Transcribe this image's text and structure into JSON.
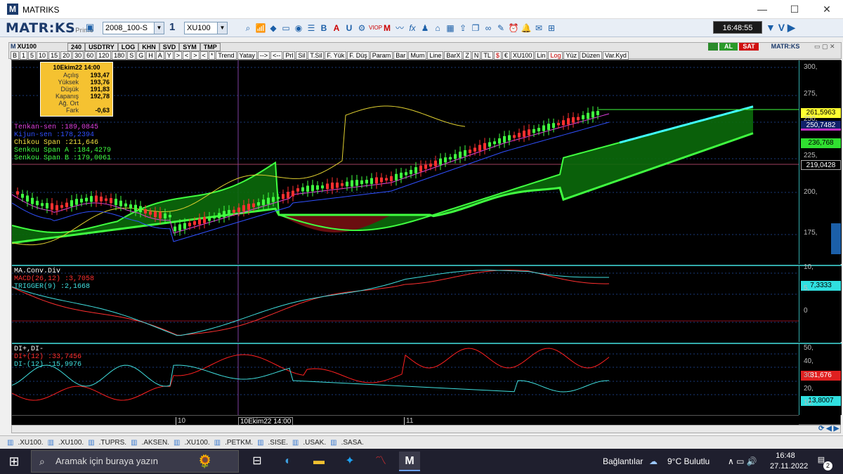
{
  "window": {
    "title": "MATRIKS",
    "min": "—",
    "max": "☐",
    "close": "✕"
  },
  "toolbar": {
    "brand": "MATR:KS",
    "brand_sub": "Prime",
    "template": "2008_100-S",
    "count": "1",
    "symbol": "XU100",
    "clock": "16:48:55"
  },
  "toolbar2": {
    "left_tabs": [
      "XU100",
      "240",
      "USDTRY",
      "LOG",
      "KHN",
      "SVD",
      "SYM",
      "TMP"
    ],
    "periods": [
      "B",
      "1",
      "5",
      "10",
      "15",
      "20",
      "30",
      "60",
      "120",
      "180",
      "S",
      "G",
      "H",
      "A",
      "Y",
      ">",
      "<",
      ">",
      "<",
      "*"
    ],
    "tools": [
      "Trend",
      "Yatay",
      "-->",
      "<--",
      "Prl",
      "Sil",
      "T.Sil",
      "F. Yük",
      "F. Düş",
      "Param",
      "Bar",
      "Mum",
      "Line",
      "BarX",
      "Z",
      "N",
      "TL",
      "$",
      "€",
      "XU100",
      "Lin",
      "Log",
      "Yüz",
      "Düzen",
      "Var.Kyd"
    ],
    "al": "AL",
    "sat": "SAT",
    "brand2": "MATR:KS"
  },
  "infobox": {
    "header": "10Ekim22 14:00",
    "rows": [
      {
        "k": "Açılış",
        "v": "193,47"
      },
      {
        "k": "Yüksek",
        "v": "193,76"
      },
      {
        "k": "Düşük",
        "v": "191,83"
      },
      {
        "k": "Kapanış",
        "v": "192,78"
      },
      {
        "k": "Ağ. Ort",
        "v": ""
      },
      {
        "k": "Fark",
        "v": "-0,63"
      }
    ]
  },
  "legend_main": [
    {
      "label": "Tenkan-sen  :189,0845",
      "color": "#e040e0"
    },
    {
      "label": "Kijun-sen   :178,2394",
      "color": "#3050ff"
    },
    {
      "label": "Chikou Span  :211,646",
      "color": "#f0e040"
    },
    {
      "label": "Senkou Span A :184,4279",
      "color": "#40ff40"
    },
    {
      "label": "Senkou Span B :179,0061",
      "color": "#40ff40"
    }
  ],
  "legend_macd": [
    {
      "label": "MA.Conv.Div",
      "color": "#ffffff"
    },
    {
      "label": "MACD(26,12)  :3,7058",
      "color": "#ff3030"
    },
    {
      "label": "TRIGGER(9)  :2,1668",
      "color": "#40e0e0"
    }
  ],
  "legend_dmi": [
    {
      "label": "DI+,DI-",
      "color": "#ffffff"
    },
    {
      "label": "DI+(12)    :33,7456",
      "color": "#ff3030"
    },
    {
      "label": "DI-(12)    :15,9976",
      "color": "#40e0e0"
    }
  ],
  "axis_main": [
    "300,",
    "275,",
    "250,",
    "225,",
    "200,",
    "175,"
  ],
  "axis_macd": [
    "10,",
    "5,",
    "0"
  ],
  "axis_dmi": [
    "50,",
    "40,",
    "30,",
    "20,",
    "10,"
  ],
  "tags": {
    "last": "261,5963",
    "tenkan": "250,7482",
    "senkouA": "236,768",
    "hline": "219,0428",
    "macd": "7,3333",
    "dip": "31,676",
    "dim": "13,8007"
  },
  "xaxis": {
    "d1": "10",
    "cursor": "10Ekim22 14:00",
    "d2": "11"
  },
  "symbol_tabs": [
    ".XU100.",
    ".XU100.",
    ".TUPRS.",
    ".AKSEN.",
    ".XU100.",
    ".PETKM.",
    ".SISE.",
    ".USAK.",
    ".SASA."
  ],
  "taskbar": {
    "search": "Aramak için buraya yazın",
    "connections": "Bağlantılar",
    "weather": "9°C  Bulutlu",
    "time": "16:48",
    "date": "27.11.2022",
    "notif": "2"
  },
  "colors": {
    "candle_up": "#40ff40",
    "candle_down": "#ff3030",
    "cloud_bull": "#0a6a0a",
    "cloud_bear": "#6a0a0a"
  }
}
